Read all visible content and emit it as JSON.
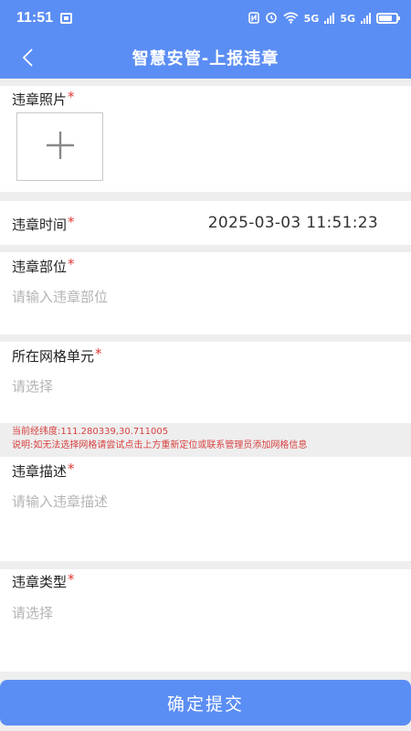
{
  "status_bar": {
    "time": "11:51",
    "network_1": "5G",
    "network_2": "5G"
  },
  "nav": {
    "title": "智慧安管-上报违章"
  },
  "form": {
    "required_mark": "*",
    "photo": {
      "label": "违章照片"
    },
    "time": {
      "label": "违章时间",
      "value": "2025-03-03 11:51:23"
    },
    "location": {
      "label": "违章部位",
      "placeholder": "请输入违章部位"
    },
    "grid": {
      "label": "所在网格单元",
      "placeholder": "请选择"
    },
    "info": {
      "coords": "当前经纬度:111.280339,30.711005",
      "note": "说明:如无法选择网格请尝试点击上方重新定位或联系管理员添加网格信息"
    },
    "description": {
      "label": "违章描述",
      "placeholder": "请输入违章描述"
    },
    "type": {
      "label": "违章类型",
      "placeholder": "请选择"
    }
  },
  "submit": {
    "label": "确定提交"
  },
  "colors": {
    "primary": "#5b8ef4",
    "required": "#e53935",
    "warning_text": "#d84040",
    "placeholder": "#b4b4b4"
  }
}
